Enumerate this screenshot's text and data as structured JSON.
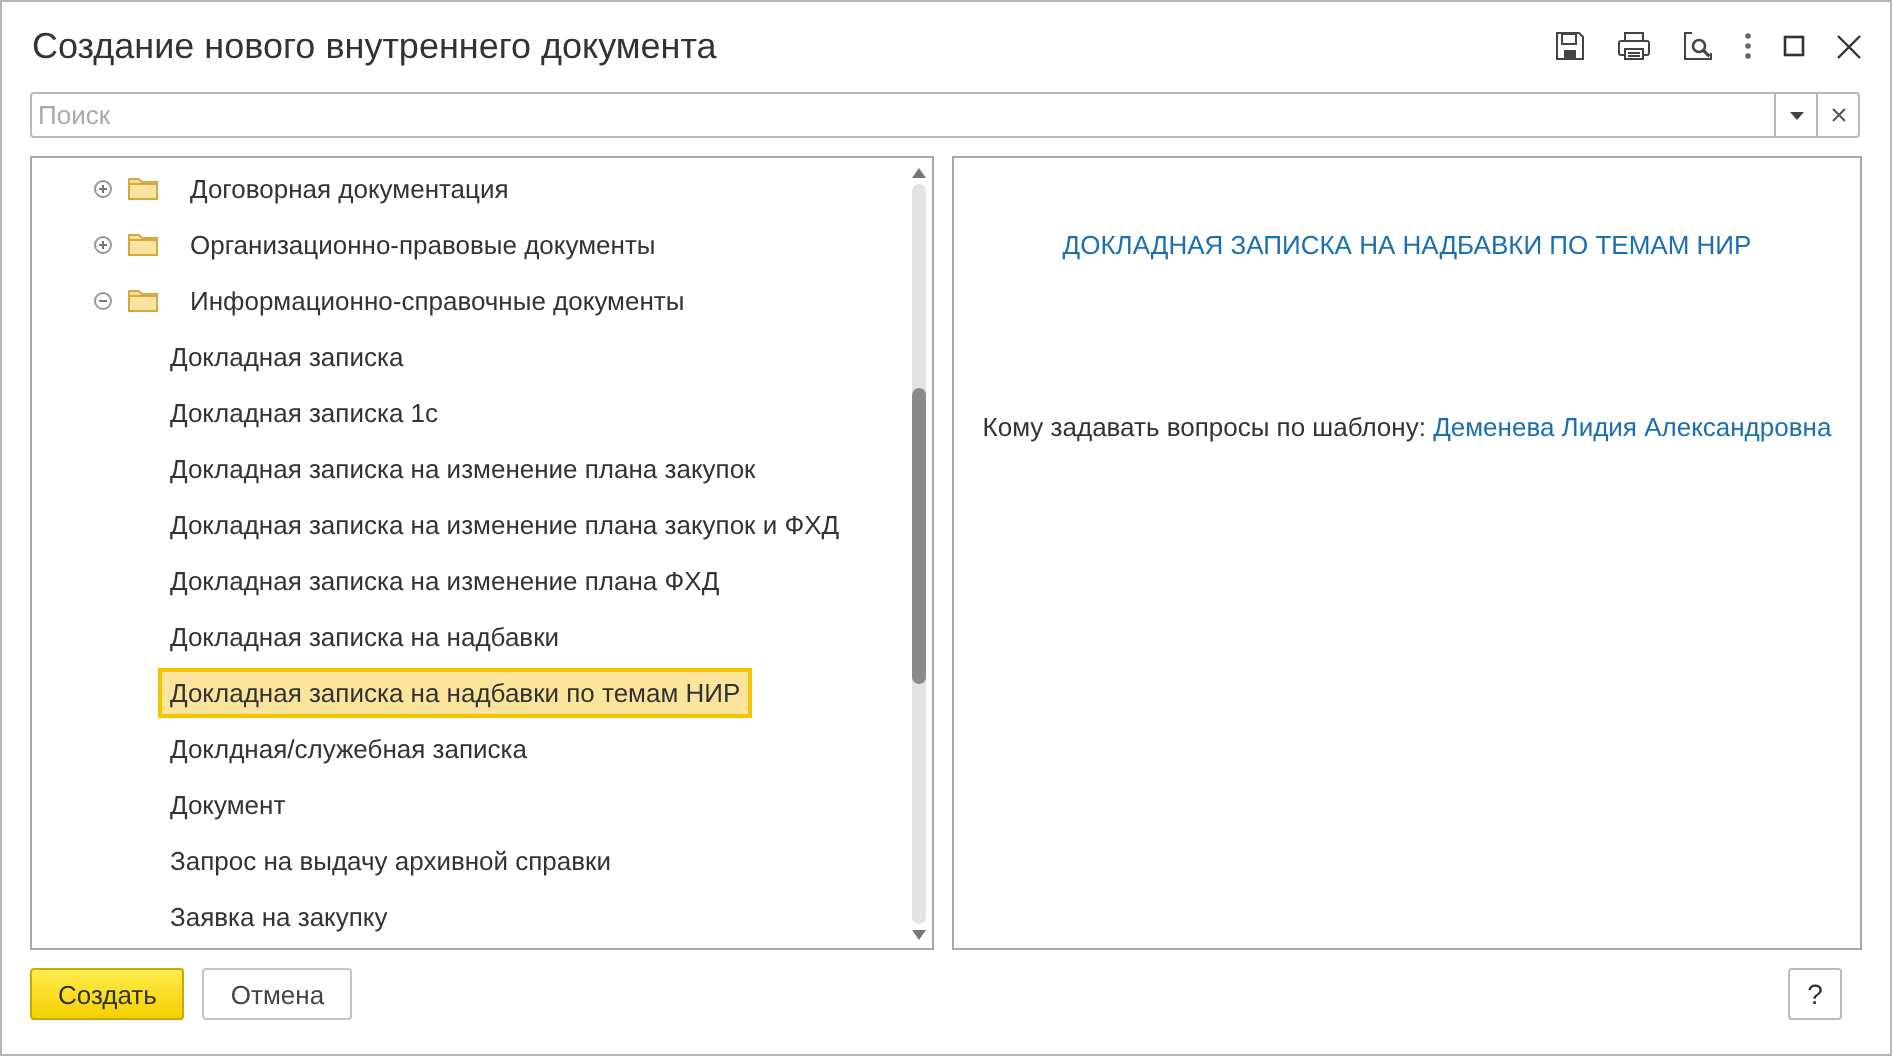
{
  "window": {
    "title": "Создание нового внутреннего документа"
  },
  "search": {
    "placeholder": "Поиск"
  },
  "tree": [
    {
      "kind": "folder",
      "label": "Договорная документация",
      "expanded": false,
      "selected": false
    },
    {
      "kind": "folder",
      "label": "Организационно-правовые документы",
      "expanded": false,
      "selected": false
    },
    {
      "kind": "folder",
      "label": "Информационно-справочные документы",
      "expanded": true,
      "selected": false,
      "children": [
        {
          "kind": "document",
          "label": "Докладная записка",
          "selected": false
        },
        {
          "kind": "document",
          "label": "Докладная записка 1с",
          "selected": false
        },
        {
          "kind": "document",
          "label": "Докладная записка на изменение плана закупок",
          "selected": false
        },
        {
          "kind": "document",
          "label": "Докладная записка на изменение плана закупок и ФХД",
          "selected": false
        },
        {
          "kind": "document",
          "label": "Докладная записка на изменение плана ФХД",
          "selected": false
        },
        {
          "kind": "document",
          "label": "Докладная записка на надбавки",
          "selected": false
        },
        {
          "kind": "document",
          "label": "Докладная записка на надбавки по темам НИР",
          "selected": true
        },
        {
          "kind": "document",
          "label": "Доклдная/служебная записка",
          "selected": false
        },
        {
          "kind": "document",
          "label": "Документ",
          "selected": false
        },
        {
          "kind": "document",
          "label": "Запрос на выдачу архивной справки",
          "selected": false
        },
        {
          "kind": "document",
          "label": "Заявка на закупку",
          "selected": false
        }
      ]
    }
  ],
  "preview": {
    "heading": "ДОКЛАДНАЯ ЗАПИСКА НА НАДБАВКИ ПО ТЕМАМ НИР",
    "contact_label": "Кому задавать вопросы по шаблону:",
    "contact_name": "Деменева Лидия Александровна"
  },
  "buttons": [
    {
      "kind": "primary",
      "label": "Создать"
    },
    {
      "kind": "secondary",
      "label": "Отмена"
    }
  ],
  "help_button": "?"
}
